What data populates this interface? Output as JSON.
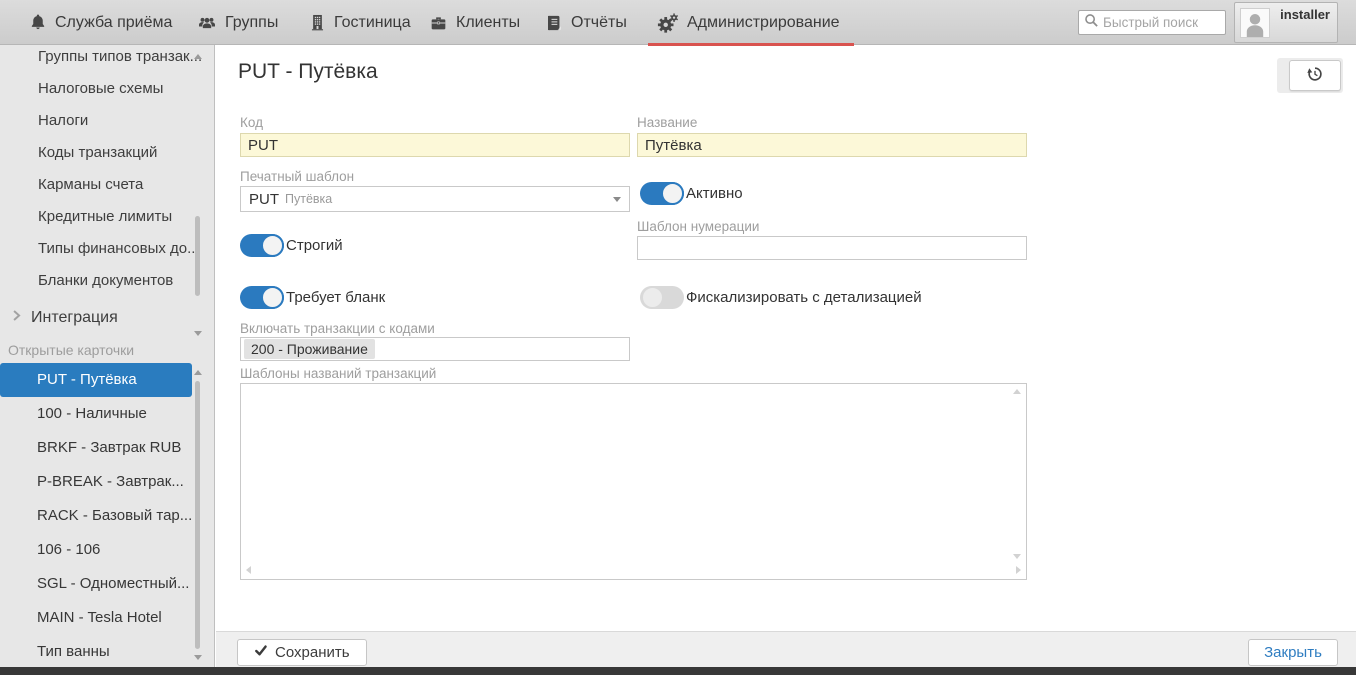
{
  "nav": {
    "items": [
      {
        "label": "Служба приёма",
        "active": false
      },
      {
        "label": "Группы",
        "active": false
      },
      {
        "label": "Гостиница",
        "active": false
      },
      {
        "label": "Клиенты",
        "active": false
      },
      {
        "label": "Отчёты",
        "active": false
      },
      {
        "label": "Администрирование",
        "active": true
      }
    ],
    "search_placeholder": "Быстрый поиск",
    "user_name": "installer"
  },
  "sidebar": {
    "menu_items": [
      "Группы типов транзак...",
      "Налоговые схемы",
      "Налоги",
      "Коды транзакций",
      "Карманы счета",
      "Кредитные лимиты",
      "Типы финансовых до...",
      "Бланки документов"
    ],
    "integration_label": "Интеграция",
    "open_cards_header": "Открытые карточки",
    "open_cards": [
      {
        "label": "PUT - Путёвка",
        "selected": true
      },
      {
        "label": "100 - Наличные",
        "selected": false
      },
      {
        "label": "BRKF - Завтрак RUB",
        "selected": false
      },
      {
        "label": "P-BREAK - Завтрак...",
        "selected": false
      },
      {
        "label": "RACK - Базовый тар...",
        "selected": false
      },
      {
        "label": "106 - 106",
        "selected": false
      },
      {
        "label": "SGL - Одноместный...",
        "selected": false
      },
      {
        "label": "MAIN - Tesla Hotel",
        "selected": false
      },
      {
        "label": "Тип ванны",
        "selected": false
      }
    ]
  },
  "main": {
    "title": "PUT - Путёвка",
    "form": {
      "code": {
        "label": "Код",
        "value": "PUT"
      },
      "name": {
        "label": "Название",
        "value": "Путёвка"
      },
      "print_template": {
        "label": "Печатный шаблон",
        "value_code": "PUT",
        "value_name": "Путёвка"
      },
      "active_toggle": {
        "label": "Активно",
        "on": true
      },
      "strict_toggle": {
        "label": "Строгий",
        "on": true
      },
      "numbering_template": {
        "label": "Шаблон нумерации",
        "value": ""
      },
      "requires_form_toggle": {
        "label": "Требует бланк",
        "on": true
      },
      "fiscalize_toggle": {
        "label": "Фискализировать с детализацией",
        "on": false
      },
      "include_transactions": {
        "label": "Включать транзакции с кодами",
        "tags": [
          "200 - Проживание"
        ]
      },
      "transaction_name_templates": {
        "label": "Шаблоны названий транзакций",
        "value": ""
      }
    },
    "footer": {
      "save_label": "Сохранить",
      "close_label": "Закрыть"
    }
  },
  "colors": {
    "accent_blue": "#2b7abf",
    "active_tab_red": "#d9534f",
    "required_field_yellow": "#fcf8d8",
    "selected_item_blue": "#2a7cbf"
  }
}
